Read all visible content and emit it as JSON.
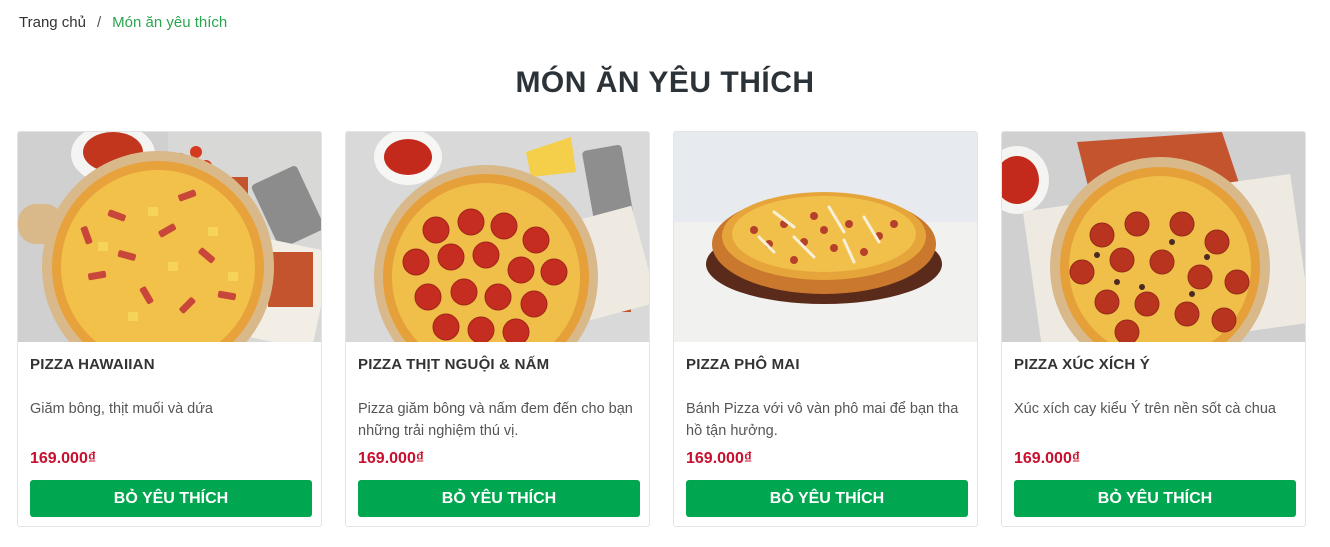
{
  "breadcrumb": {
    "home": "Trang chủ",
    "separator": "/",
    "current": "Món ăn yêu thích"
  },
  "page_title": "MÓN ĂN YÊU THÍCH",
  "colors": {
    "accent": "#00a650",
    "price": "#c8102e",
    "breadcrumb_current": "#2aa54f"
  },
  "products": [
    {
      "name": "PIZZA HAWAIIAN",
      "description": "Giăm bông, thịt muối và dứa",
      "price": "169.000₫",
      "button": "BỎ YÊU THÍCH",
      "image_icon": "pizza-hawaiian-image"
    },
    {
      "name": "PIZZA THỊT NGUỘI & NẤM",
      "description": "Pizza giăm bông và nấm đem đến cho bạn những trải nghiệm thú vị.",
      "price": "169.000₫",
      "button": "BỎ YÊU THÍCH",
      "image_icon": "pizza-pepperoni-image"
    },
    {
      "name": "PIZZA PHÔ MAI",
      "description": "Bánh Pizza với vô vàn phô mai để bạn tha hồ tận hưởng.",
      "price": "169.000₫",
      "button": "BỎ YÊU THÍCH",
      "image_icon": "pizza-cheese-image"
    },
    {
      "name": "PIZZA XÚC XÍCH Ý",
      "description": "Xúc xích cay kiểu Ý trên nền sốt cà chua",
      "price": "169.000₫",
      "button": "BỎ YÊU THÍCH",
      "image_icon": "pizza-sausage-image"
    }
  ]
}
